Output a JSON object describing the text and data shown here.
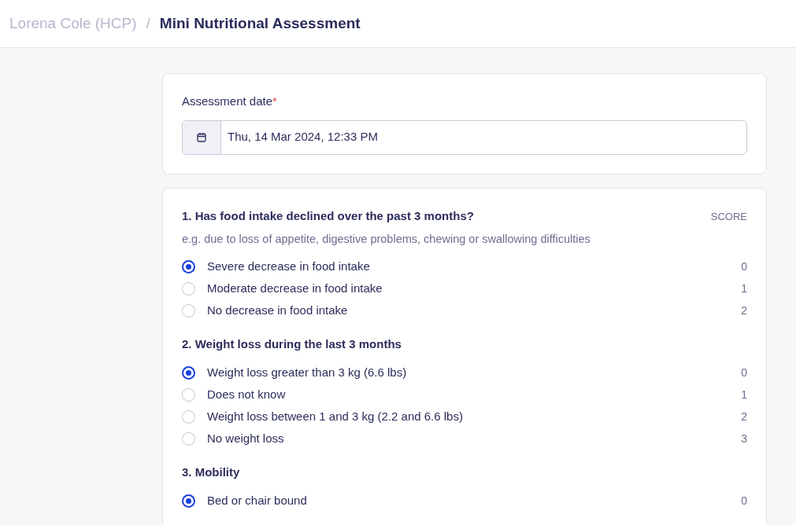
{
  "breadcrumb": {
    "parent": "Lorena Cole (HCP)",
    "separator": "/",
    "current": "Mini Nutritional Assessment"
  },
  "assessment_date": {
    "label": "Assessment date",
    "required_mark": "*",
    "value": "Thu, 14 Mar 2024, 12:33 PM"
  },
  "score_header": "SCORE",
  "questions": [
    {
      "title": "1. Has food intake declined over the past 3 months?",
      "hint": "e.g. due to loss of appetite, digestive problems, chewing or swallowing difficulties",
      "options": [
        {
          "label": "Severe decrease in food intake",
          "score": "0",
          "selected": true
        },
        {
          "label": "Moderate decrease in food intake",
          "score": "1",
          "selected": false
        },
        {
          "label": "No decrease in food intake",
          "score": "2",
          "selected": false
        }
      ]
    },
    {
      "title": "2. Weight loss during the last 3 months",
      "options": [
        {
          "label": "Weight loss greater than 3 kg (6.6 lbs)",
          "score": "0",
          "selected": true
        },
        {
          "label": "Does not know",
          "score": "1",
          "selected": false
        },
        {
          "label": "Weight loss between 1 and 3 kg (2.2 and 6.6 lbs)",
          "score": "2",
          "selected": false
        },
        {
          "label": "No weight loss",
          "score": "3",
          "selected": false
        }
      ]
    },
    {
      "title": "3. Mobility",
      "options": [
        {
          "label": "Bed or chair bound",
          "score": "0",
          "selected": true
        }
      ]
    }
  ]
}
